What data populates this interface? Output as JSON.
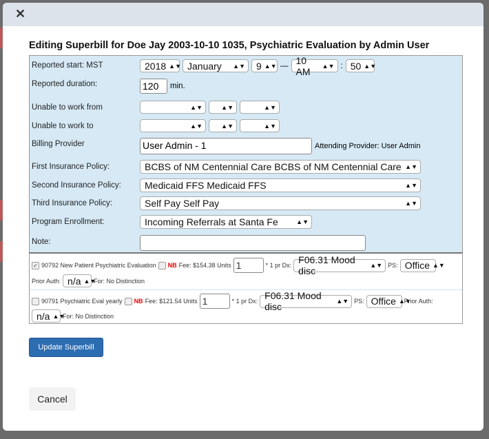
{
  "dialog": {
    "close_icon": "close-x",
    "title": "Editing Superbill for Doe Jay 2003-10-10 1035, Psychiatric Evaluation by Admin User"
  },
  "form": {
    "reported_start": {
      "label": "Reported start: MST",
      "year": "2018",
      "month": "January",
      "day": "9",
      "dash": "—",
      "hour": "10 AM",
      "colon": ":",
      "minute": "50"
    },
    "reported_duration": {
      "label": "Reported duration:",
      "value": "120",
      "unit": "min."
    },
    "unable_from": {
      "label": "Unable to work from"
    },
    "unable_to": {
      "label": "Unable to work to"
    },
    "billing_provider": {
      "label": "Billing Provider",
      "value": "User Admin - 1",
      "attending": "Attending Provider: User Admin"
    },
    "first_policy": {
      "label": "First Insurance Policy:",
      "value": "BCBS of NM Centennial Care BCBS of NM Centennial Care"
    },
    "second_policy": {
      "label": "Second Insurance Policy:",
      "value": "Medicaid FFS Medicaid FFS"
    },
    "third_policy": {
      "label": "Third Insurance Policy:",
      "value": "Self Pay Self Pay"
    },
    "program_enrollment": {
      "label": "Program Enrollment:",
      "value": "Incoming Referrals at Santa Fe"
    },
    "note": {
      "label": "Note:",
      "value": ""
    }
  },
  "items": [
    {
      "checked": true,
      "code": "90792 New Patient Psychiatric Evaluation",
      "nb": "NB",
      "fee": "Fee: $154.38 Units",
      "units": "1",
      "per": "* 1 pr Dx:",
      "dx": "F06.31 Mood disc",
      "ps_label": "PS:",
      "ps": "Office",
      "prior_label": "Prior Auth:",
      "prior": "n/a",
      "for": "For: No Distinction"
    },
    {
      "checked": false,
      "code": "90791 Psychiatric Eval yearly",
      "nb": "NB",
      "fee": "Fee: $121.54 Units",
      "units": "1",
      "per": "* 1 pr Dx:",
      "dx": "F06.31 Mood disc",
      "ps_label": "PS:",
      "ps": "Office",
      "prior_label": "Prior Auth:",
      "prior": "n/a",
      "for": "For: No Distinction"
    }
  ],
  "buttons": {
    "update": "Update Superbill",
    "cancel": "Cancel"
  },
  "colors": {
    "form_bg": "#d6e9f5",
    "primary": "#2c6db2",
    "nb": "#ee0000"
  }
}
